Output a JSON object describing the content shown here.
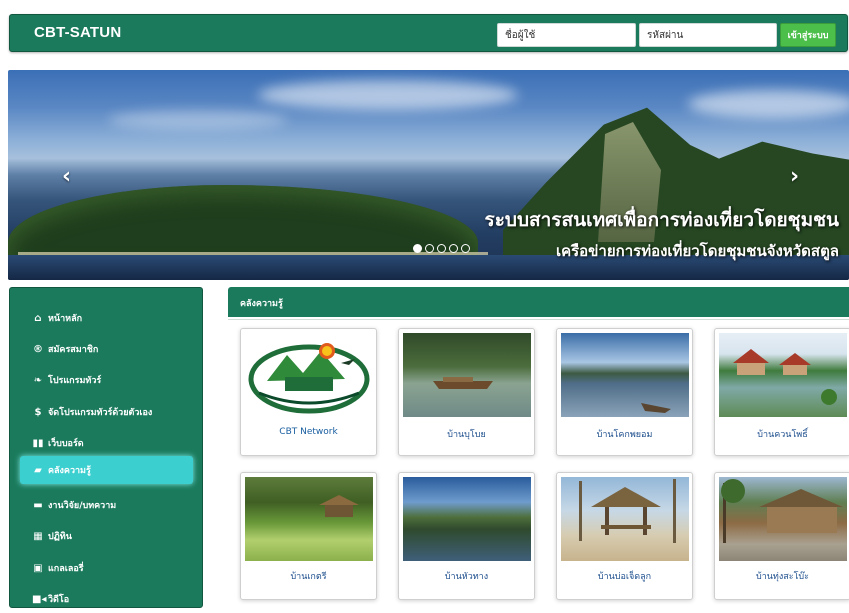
{
  "navbar": {
    "brand": "CBT-SATUN",
    "username_placeholder": "ชื่อผู้ใช้",
    "password_placeholder": "รหัสผ่าน",
    "login_label": "เข้าสู่ระบบ"
  },
  "carousel": {
    "title": "ระบบสารสนเทศเพื่อการท่องเที่ยวโดยชุมชน",
    "subtitle": "เครือข่ายการท่องเที่ยวโดยชุมชนจังหวัดสตูล",
    "prev_icon": "chevron-left-icon",
    "next_icon": "chevron-right-icon",
    "slide_count": 5,
    "active_slide": 1
  },
  "sidebar": {
    "items": [
      {
        "label": "หน้าหลัก",
        "icon": "home-icon",
        "glyph": "⌂"
      },
      {
        "label": "สมัครสมาชิก",
        "icon": "register-icon",
        "glyph": "®"
      },
      {
        "label": "โปรแกรมทัวร์",
        "icon": "leaf-icon",
        "glyph": "❧"
      },
      {
        "label": "จัดโปรแกรมทัวร์ด้วยตัวเอง",
        "icon": "dollar-icon",
        "glyph": "$"
      },
      {
        "label": "เว็บบอร์ด",
        "icon": "board-icon",
        "glyph": "▮▮"
      },
      {
        "label": "คลังความรู้",
        "icon": "book-icon",
        "glyph": "▰"
      },
      {
        "label": "งานวิจัย/บทความ",
        "icon": "folder-icon",
        "glyph": "▬"
      },
      {
        "label": "ปฏิทิน",
        "icon": "calendar-icon",
        "glyph": "▦"
      },
      {
        "label": "แกลเลอรี่",
        "icon": "picture-icon",
        "glyph": "▣"
      },
      {
        "label": "วิดีโอ",
        "icon": "video-icon",
        "glyph": "■◂"
      }
    ],
    "active_index": 5
  },
  "main": {
    "header": "คลังความรู้",
    "cards": [
      {
        "title": "CBT Network"
      },
      {
        "title": "บ้านบุโบย"
      },
      {
        "title": "บ้านโคกพยอม"
      },
      {
        "title": "บ้านควนโพธิ์"
      },
      {
        "title": "บ้านเกตรี"
      },
      {
        "title": "บ้านหัวทาง"
      },
      {
        "title": "บ้านบ่อเจ็ดลูก"
      },
      {
        "title": "บ้านทุ่งสะโบ๊ะ"
      }
    ]
  },
  "colors": {
    "primary_green": "#1b7a5c",
    "active_cyan": "#3ccfd0",
    "login_green": "#4bbf4a",
    "card_title_blue": "#1b4d8c"
  }
}
